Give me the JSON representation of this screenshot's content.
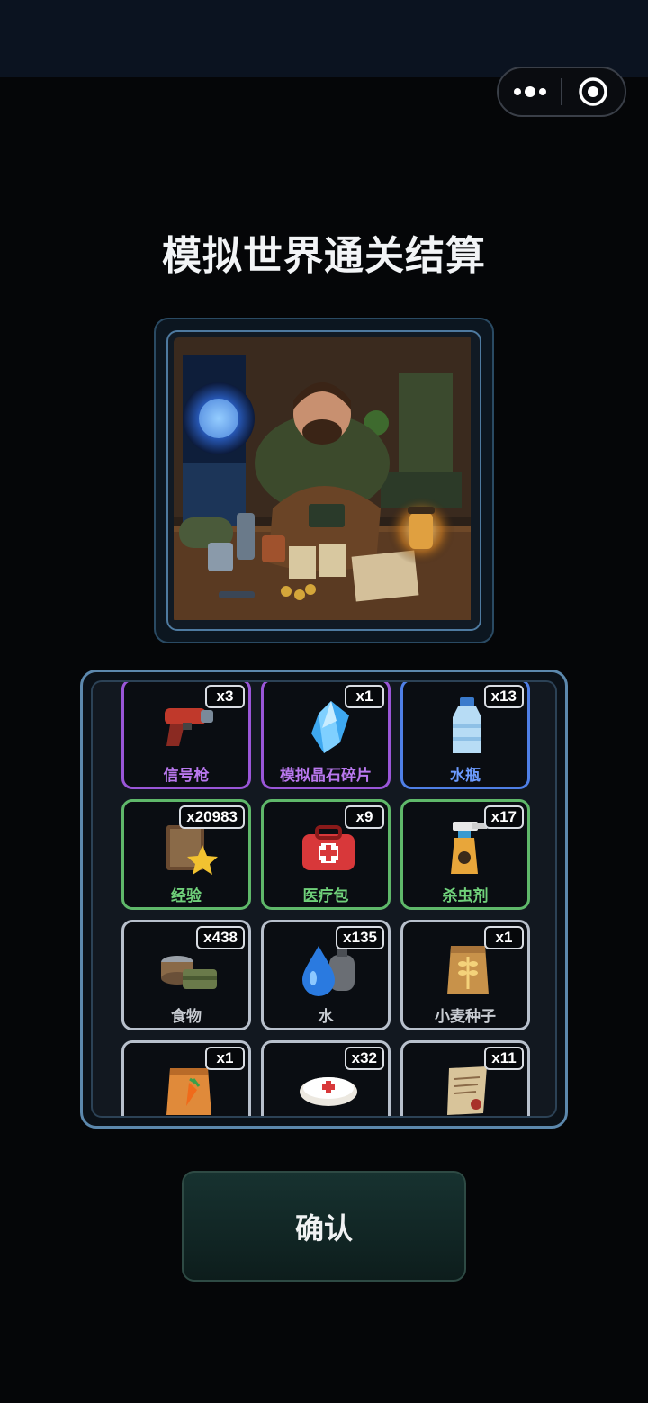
{
  "capsule": {
    "more_icon": "more-dots-icon",
    "close_icon": "target-close-icon"
  },
  "title": "模拟世界通关结算",
  "image": {
    "subject": "illustration"
  },
  "items": [
    {
      "name": "信号枪",
      "qty": "x3",
      "rarity": "purple",
      "icon": "flare-gun-icon"
    },
    {
      "name": "模拟晶石碎片",
      "qty": "x1",
      "rarity": "purple",
      "icon": "crystal-shard-icon"
    },
    {
      "name": "水瓶",
      "qty": "x13",
      "rarity": "blue",
      "icon": "water-bottle-icon"
    },
    {
      "name": "经验",
      "qty": "x20983",
      "rarity": "green",
      "icon": "experience-book-icon"
    },
    {
      "name": "医疗包",
      "qty": "x9",
      "rarity": "green",
      "icon": "medkit-icon"
    },
    {
      "name": "杀虫剂",
      "qty": "x17",
      "rarity": "green",
      "icon": "insecticide-icon"
    },
    {
      "name": "食物",
      "qty": "x438",
      "rarity": "white",
      "icon": "food-icon"
    },
    {
      "name": "水",
      "qty": "x135",
      "rarity": "white",
      "icon": "water-drop-icon"
    },
    {
      "name": "小麦种子",
      "qty": "x1",
      "rarity": "white",
      "icon": "wheat-seed-icon"
    },
    {
      "name": "",
      "qty": "x1",
      "rarity": "white",
      "icon": "carrot-seed-icon"
    },
    {
      "name": "",
      "qty": "x32",
      "rarity": "white",
      "icon": "bandage-icon"
    },
    {
      "name": "",
      "qty": "x11",
      "rarity": "white",
      "icon": "scroll-icon"
    }
  ],
  "confirm_label": "确认",
  "colors": {
    "purple": "#9a56d8",
    "blue": "#4f7fe6",
    "green": "#5fb86a",
    "white": "#b8c0cc"
  }
}
